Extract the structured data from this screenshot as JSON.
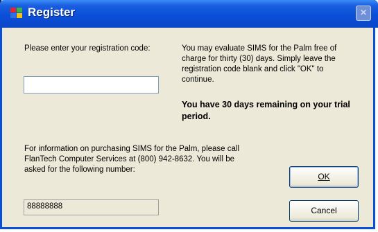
{
  "window": {
    "title": "Register",
    "close_glyph": "×"
  },
  "left": {
    "prompt": "Please enter your registration code:",
    "code_value": ""
  },
  "right": {
    "info": "You may evaluate SIMS for the Palm free of charge for thirty (30) days. Simply leave the registration code blank and click \"OK\" to continue.",
    "trial_status": "You have 30 days remaining on your trial period."
  },
  "bottom": {
    "purchase_info": "For information on purchasing SIMS for the Palm, please call FlanTech Computer Services at (800) 942-8632.  You will be asked for the following number:",
    "number_value": "88888888"
  },
  "buttons": {
    "ok_label": "OK",
    "cancel_label": "Cancel"
  },
  "icons": {
    "title": "app-flag-icon",
    "close": "close-icon"
  }
}
